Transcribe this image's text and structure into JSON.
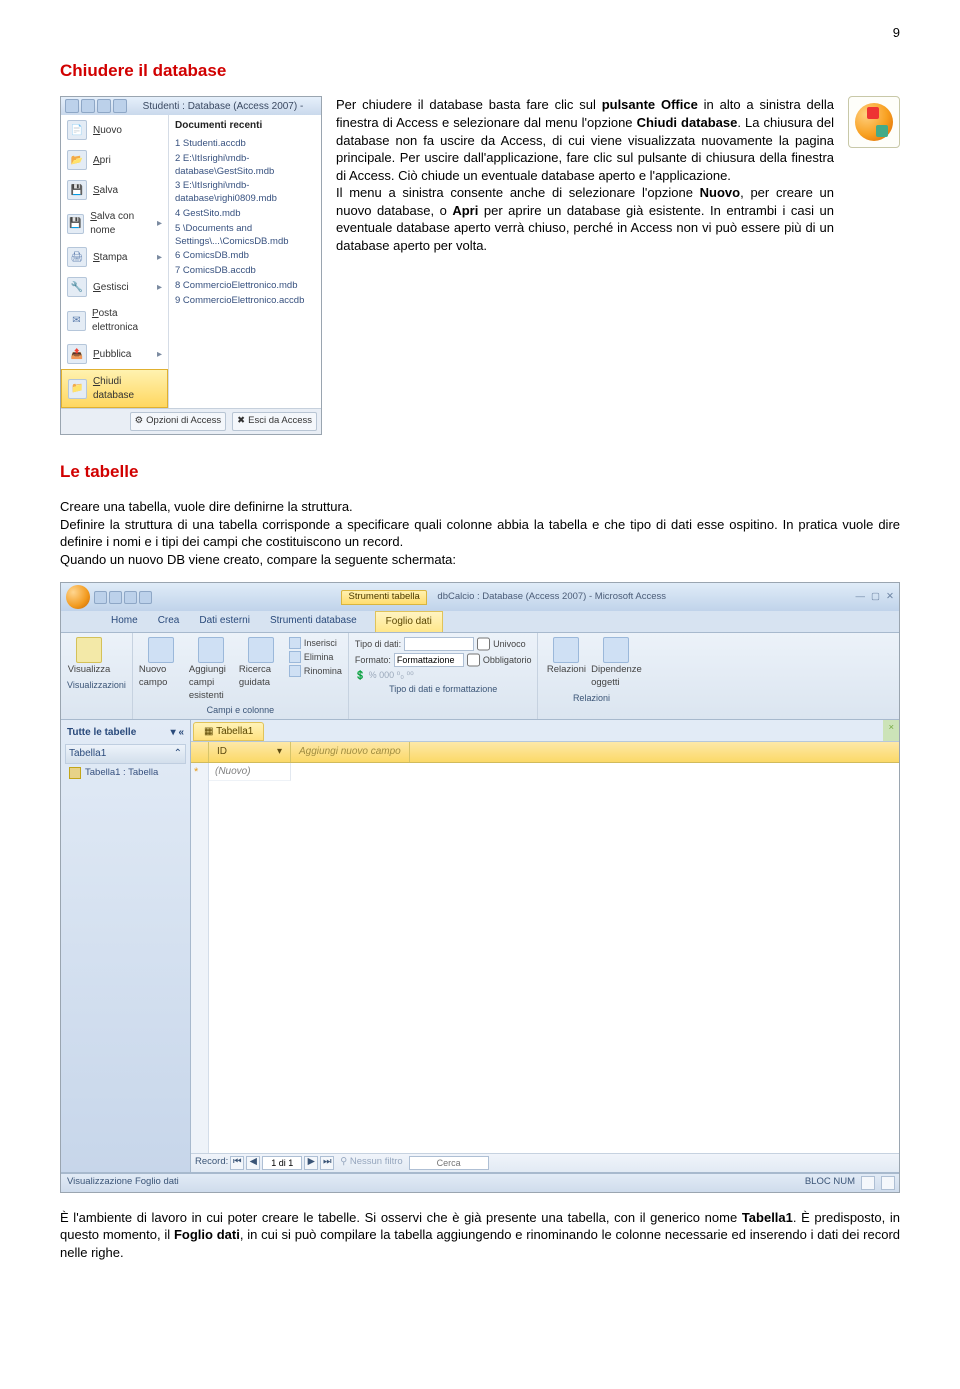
{
  "page_number": "9",
  "heading1": "Chiudere il database",
  "heading2": "Le tabelle",
  "office_menu": {
    "title": "Studenti : Database (Access 2007) -",
    "left_items": [
      {
        "label": "Nuovo",
        "icon": "📄"
      },
      {
        "label": "Apri",
        "icon": "📂"
      },
      {
        "label": "Salva",
        "icon": "💾"
      },
      {
        "label": "Salva con nome",
        "icon": "💾",
        "arrow": "▸"
      },
      {
        "label": "Stampa",
        "icon": "🖨",
        "arrow": "▸"
      },
      {
        "label": "Gestisci",
        "icon": "🔧",
        "arrow": "▸"
      },
      {
        "label": "Posta elettronica",
        "icon": "✉"
      },
      {
        "label": "Pubblica",
        "icon": "📤",
        "arrow": "▸"
      },
      {
        "label": "Chiudi database",
        "icon": "📁",
        "hl": true
      }
    ],
    "recent_header": "Documenti recenti",
    "recent": [
      "1 Studenti.accdb",
      "2 E:\\ItIsrighi\\mdb-database\\GestSito.mdb",
      "3 E:\\ItIsrighi\\mdb-database\\righi0809.mdb",
      "4 GestSito.mdb",
      "5 \\Documents and Settings\\...\\ComicsDB.mdb",
      "6 ComicsDB.mdb",
      "7 ComicsDB.accdb",
      "8 CommercioElettronico.mdb",
      "9 CommercioElettronico.accdb"
    ],
    "footer": {
      "opzioni": "Opzioni di Access",
      "esci": "Esci da Access"
    }
  },
  "para1": {
    "t1": "Per chiudere il database basta fare clic sul ",
    "b1": "pulsante Office",
    "t2": " in alto a sinistra della finestra di Access e selezionare dal menu l'opzione ",
    "b2": "Chiudi database",
    "t3": ". La chiusura del database non fa uscire da Access, di cui viene visualizzata nuovamente la pagina principale. Per uscire dall'applicazione, fare clic sul pulsante di chiusura della finestra di Access. Ciò chiude un eventuale database aperto e l'applicazione.",
    "t4": "Il menu a sinistra consente anche di selezionare l'opzione ",
    "b3": "Nuovo",
    "t5": ", per creare un nuovo database, o ",
    "b4": "Apri",
    "t6": " per aprire un database già esistente. In entrambi i casi un eventuale database aperto verrà chiuso, perché in Access non vi può essere più di un database aperto per volta."
  },
  "para2": "Creare una tabella, vuole dire definirne la struttura.\nDefinire la struttura di una tabella corrisponde a specificare quali colonne abbia la tabella e che tipo di dati esse ospitino. In pratica vuole dire definire i nomi e i tipi dei campi che costituiscono un record.\nQuando un nuovo DB viene creato, compare la seguente schermata:",
  "access": {
    "title_tool": "Strumenti tabella",
    "title": "dbCalcio : Database (Access 2007) - Microsoft Access",
    "tabs": [
      "Home",
      "Crea",
      "Dati esterni",
      "Strumenti database"
    ],
    "ctx_tab": "Foglio dati",
    "ribbon": {
      "visualizza": "Visualizza",
      "nuovo_campo": "Nuovo campo",
      "aggiungi": "Aggiungi campi esistenti",
      "ricerca": "Ricerca guidata",
      "inserisci": "Inserisci",
      "elimina": "Elimina",
      "rinomina": "Rinomina",
      "tipo_dati": "Tipo di dati:",
      "formato": "Formato:",
      "formattazione": "Formattazione",
      "univoco": "Univoco",
      "obbligatorio": "Obbligatorio",
      "relazioni": "Relazioni",
      "dipendenze": "Dipendenze oggetti",
      "grp_vis": "Visualizzazioni",
      "grp_campi": "Campi e colonne",
      "grp_fmt": "Tipo di dati e formattazione",
      "grp_rel": "Relazioni"
    },
    "nav": {
      "header": "Tutte le tabelle",
      "group": "Tabella1",
      "item": "Tabella1 : Tabella"
    },
    "sheet": {
      "tab": "Tabella1",
      "col_id": "ID",
      "col_new": "Aggiungi nuovo campo",
      "row_new": "(Nuovo)"
    },
    "status": {
      "left": "Visualizzazione Foglio dati",
      "record": "Record:",
      "recval": "1 di 1",
      "filter": "Nessun filtro",
      "search": "Cerca",
      "caps": "BLOC NUM"
    }
  },
  "para3": {
    "t1": "È l'ambiente di lavoro in cui poter creare le tabelle. Si osservi che è già presente una tabella, con il generico nome ",
    "b1": "Tabella1",
    "t2": ". È predisposto, in questo momento, il ",
    "b2": "Foglio dati",
    "t3": ", in cui si può compilare la tabella aggiungendo e rinominando le colonne necessarie ed inserendo i dati dei record nelle righe."
  }
}
